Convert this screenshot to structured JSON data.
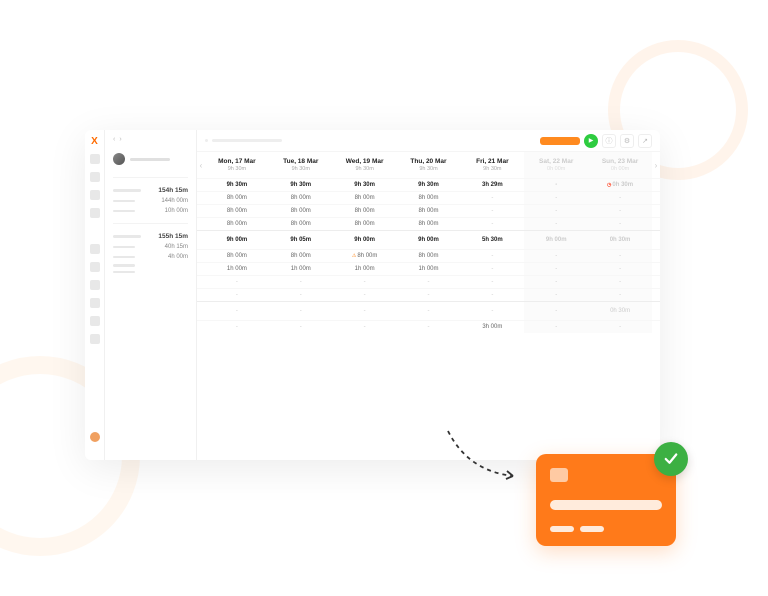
{
  "colors": {
    "accent": "#ff7a1a",
    "play": "#2ecc40",
    "success": "#3cb043"
  },
  "nav": {
    "icons": [
      "dashboard",
      "clock",
      "calendar",
      "users",
      "back",
      "chart",
      "report",
      "box",
      "loop",
      "share"
    ]
  },
  "projects": {
    "nav_prev": "‹",
    "nav_next": "›",
    "group1": {
      "total": "154h 15m",
      "items": [
        {
          "val": "144h 00m"
        },
        {
          "val": "10h 00m"
        }
      ]
    },
    "group2": {
      "total": "155h 15m",
      "items": [
        {
          "val": "40h 15m"
        },
        {
          "val": "4h 00m"
        }
      ]
    }
  },
  "topbar": {
    "play": "▶",
    "info": "ⓘ",
    "settings": "⚙",
    "export": "↗"
  },
  "days": [
    {
      "label": "Mon, 17 Mar",
      "sum": "9h 30m",
      "dim": false
    },
    {
      "label": "Tue, 18 Mar",
      "sum": "9h 30m",
      "dim": false
    },
    {
      "label": "Wed, 19 Mar",
      "sum": "9h 30m",
      "dim": false
    },
    {
      "label": "Thu, 20 Mar",
      "sum": "9h 30m",
      "dim": false
    },
    {
      "label": "Fri, 21 Mar",
      "sum": "9h 30m",
      "dim": false
    },
    {
      "label": "Sat, 22 Mar",
      "sum": "0h 00m",
      "dim": true
    },
    {
      "label": "Sun, 23 Mar",
      "sum": "0h 00m",
      "dim": true
    }
  ],
  "block1": {
    "head": [
      "9h 30m",
      "9h 30m",
      "9h 30m",
      "9h 30m",
      "3h 29m",
      "-",
      "0h 30m"
    ],
    "head_flags": [
      "",
      "",
      "",
      "",
      "",
      "",
      "clock"
    ],
    "rows": [
      [
        "8h 00m",
        "8h 00m",
        "8h 00m",
        "8h 00m",
        "-",
        "-",
        "-"
      ],
      [
        "8h 00m",
        "8h 00m",
        "8h 00m",
        "8h 00m",
        "-",
        "-",
        "-"
      ],
      [
        "8h 00m",
        "8h 00m",
        "8h 00m",
        "8h 00m",
        "-",
        "-",
        "-"
      ]
    ]
  },
  "block2": {
    "head": [
      "9h 00m",
      "9h 05m",
      "9h 00m",
      "9h 00m",
      "5h 30m",
      "9h 00m",
      "0h 30m"
    ],
    "rows": [
      [
        "8h 00m",
        "8h 00m",
        "8h 00m",
        "8h 00m",
        "-",
        "-",
        "-"
      ],
      [
        "1h 00m",
        "1h 00m",
        "1h 00m",
        "1h 00m",
        "-",
        "-",
        "-"
      ],
      [
        "-",
        "-",
        "-",
        "-",
        "-",
        "-",
        "-"
      ],
      [
        "-",
        "-",
        "-",
        "-",
        "-",
        "-",
        "-"
      ]
    ],
    "row_flags": [
      [
        "",
        "",
        "warn",
        "",
        "",
        "",
        ""
      ],
      [
        "",
        "",
        "",
        "",
        "",
        "",
        ""
      ],
      [
        "",
        "",
        "",
        "",
        "",
        "",
        ""
      ],
      [
        "",
        "",
        "",
        "",
        "",
        "",
        ""
      ]
    ]
  },
  "block3": {
    "rows": [
      [
        "-",
        "-",
        "-",
        "-",
        "-",
        "-",
        "0h 30m"
      ],
      [
        "-",
        "-",
        "-",
        "-",
        "3h 00m",
        "-",
        "-"
      ]
    ]
  },
  "grid_nav": {
    "prev": "‹",
    "next": "›"
  }
}
